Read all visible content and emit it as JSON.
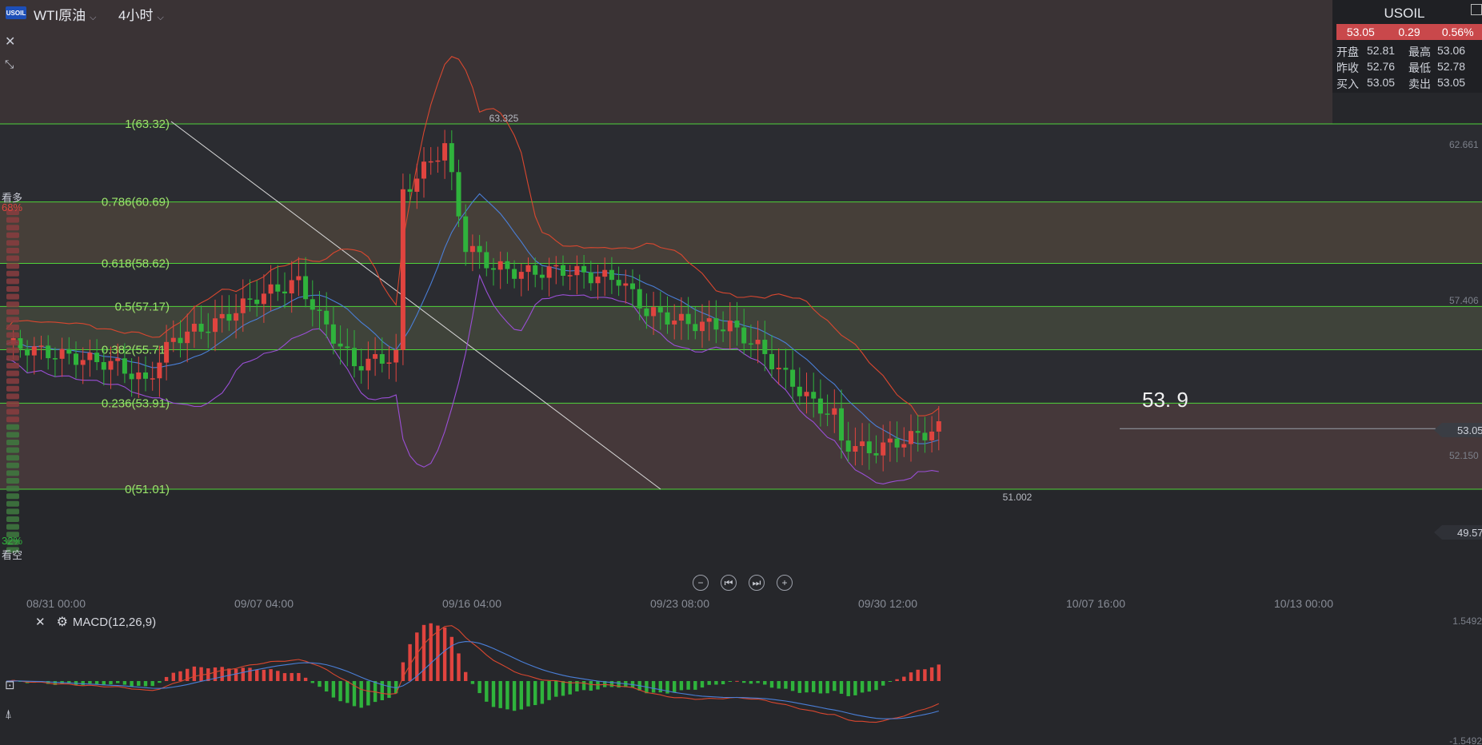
{
  "header": {
    "symbol_badge": "USOIL",
    "symbol_name": "WTI原油",
    "timeframe": "4小时"
  },
  "quote": {
    "title": "USOIL",
    "price": "53.05",
    "change": "0.29",
    "change_pct": "0.56%",
    "open_label": "开盘",
    "open": "52.81",
    "high_label": "最高",
    "high": "53.06",
    "prev_label": "昨收",
    "prev": "52.76",
    "low_label": "最低",
    "low": "52.78",
    "bid_label": "买入",
    "bid": "53.05",
    "ask_label": "卖出",
    "ask": "53.05"
  },
  "sentiment": {
    "bull_label": "看多",
    "bull_pct": "68%",
    "bear_pct": "32%",
    "bear_label": "看空"
  },
  "annotation": {
    "target": "53. 9",
    "peak_label": "63.325",
    "low_label": "51.002"
  },
  "price_axis": {
    "labels": [
      "62.661",
      "57.406",
      "53.05",
      "52.150",
      "49.57"
    ],
    "current_price_tag": "53.05"
  },
  "time_axis": [
    "08/31 00:00",
    "09/07 04:00",
    "09/16 04:00",
    "09/23 08:00",
    "09/30 12:00",
    "10/07 16:00",
    "10/13 00:00"
  ],
  "indicator": {
    "name": "MACD(12,26,9)",
    "axis_top": "1.5492",
    "axis_bottom": "-1.5492"
  },
  "colors": {
    "up": "#e0443f",
    "down": "#2fb33c",
    "fib": "#4fd33a",
    "bg": "#26272b"
  },
  "chart_data": {
    "type": "candlestick",
    "fibonacci": [
      {
        "label": "1(63.32)",
        "price": 63.32
      },
      {
        "label": "0.786(60.69)",
        "price": 60.69
      },
      {
        "label": "0.618(58.62)",
        "price": 58.62
      },
      {
        "label": "0.5(57.17)",
        "price": 57.17
      },
      {
        "label": "0.382(55.71)",
        "price": 55.71
      },
      {
        "label": "0.236(53.91)",
        "price": 53.91
      },
      {
        "label": "0(51.01)",
        "price": 51.01
      }
    ],
    "ylim": [
      49.57,
      66.4
    ],
    "last_price": 53.05,
    "peak": 63.325,
    "trough": 51.002
  }
}
